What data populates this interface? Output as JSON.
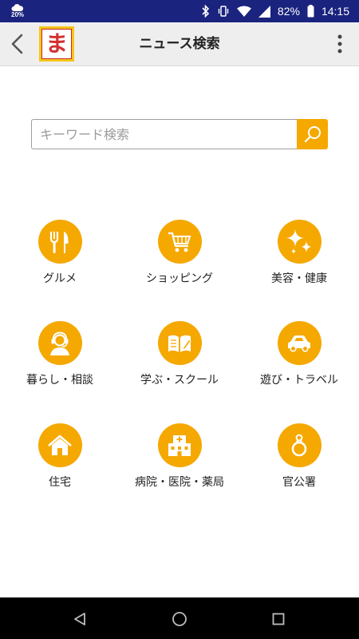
{
  "status_bar": {
    "weather_icon": "cloud-icon",
    "temperature": "20%",
    "battery_percent": "82%",
    "time": "14:15",
    "icons": [
      "bluetooth-icon",
      "vibrate-icon",
      "wifi-icon",
      "signal-icon",
      "battery-icon"
    ]
  },
  "app_bar": {
    "back_icon": "back-arrow-icon",
    "logo_char": "ま",
    "title": "ニュース検索",
    "more_icon": "more-vert-icon"
  },
  "search": {
    "placeholder": "キーワード検索",
    "value": "",
    "button_icon": "search-icon"
  },
  "categories": [
    {
      "label": "グルメ",
      "icon": "fork-knife-icon"
    },
    {
      "label": "ショッピング",
      "icon": "shopping-cart-icon"
    },
    {
      "label": "美容・健康",
      "icon": "sparkle-icon"
    },
    {
      "label": "暮らし・相談",
      "icon": "headset-person-icon"
    },
    {
      "label": "学ぶ・スクール",
      "icon": "open-book-icon"
    },
    {
      "label": "遊び・トラベル",
      "icon": "car-icon"
    },
    {
      "label": "住宅",
      "icon": "house-icon"
    },
    {
      "label": "病院・医院・薬局",
      "icon": "hospital-icon"
    },
    {
      "label": "官公署",
      "icon": "ring-icon"
    }
  ],
  "colors": {
    "accent": "#f5a800",
    "status_bar": "#1a237e",
    "app_bar": "#eeeeee",
    "logo_red": "#d32f2f"
  },
  "nav_bar": {
    "back": "nav-back-icon",
    "home": "nav-home-icon",
    "recents": "nav-recents-icon"
  }
}
